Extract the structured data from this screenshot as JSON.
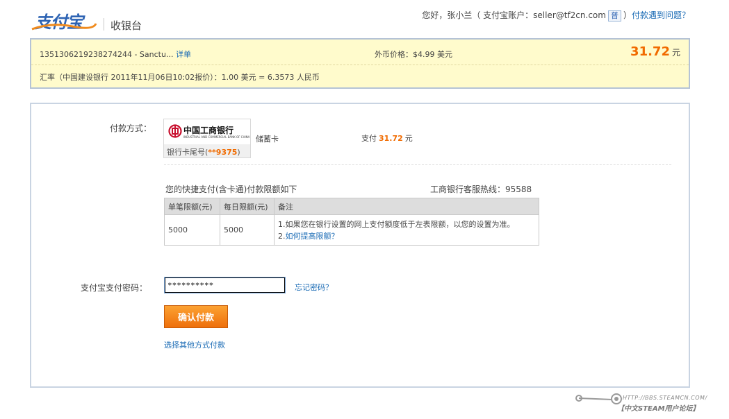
{
  "header": {
    "logo_text": "支付宝",
    "cashier_label": "收银台",
    "greeting": "您好，张小兰（ 支付宝账户：seller@tf2cn.com",
    "account_type_badge": "普",
    "greeting_close": "）",
    "help_link": "付款遇到问题？"
  },
  "order": {
    "id_text": "1351306219238274244 - Sanctu...",
    "detail_link": "详单",
    "foreign_price": "外币价格：$4.99 美元",
    "amount": "31.72",
    "amount_unit": "元",
    "exchange_rate": "汇率（中国建设银行 2011年11月06日10:02报价）：1.00 美元 = 6.3573 人民币"
  },
  "payment": {
    "method_label": "付款方式：",
    "bank": {
      "name": "中国工商银行",
      "english_name": "INDUSTRIAL AND COMMERCIAL BANK OF CHINA",
      "tail_prefix": "银行卡尾号(",
      "tail_digits": "**9375",
      "tail_suffix": ")"
    },
    "card_type": "储蓄卡",
    "pay_prefix": "支付",
    "pay_amount": "31.72",
    "pay_unit": "元"
  },
  "limits": {
    "title": "您的快捷支付(含卡通)付款限额如下",
    "hotline": "工商银行客服热线：95588",
    "headers": [
      "单笔限额(元)",
      "每日限额(元)",
      "备注"
    ],
    "row": {
      "single": "5000",
      "daily": "5000",
      "note_line1": "1.如果您在银行设置的网上支付额度低于左表限额，以您的设置为准。",
      "note_line2_prefix": "2.",
      "note_line2_link": "如何提高限额？"
    }
  },
  "password": {
    "label": "支付宝支付密码：",
    "value": "**********",
    "forgot_link": "忘记密码？"
  },
  "confirm_button": "确认付款",
  "other_method_link": "选择其他方式付款",
  "watermark": {
    "line1": "HTTP://BBS.STEAMCN.COM/",
    "line2": "【中文STEAM用户论坛】"
  },
  "colors": {
    "accent_orange": "#f16b00",
    "link_blue": "#1a6bb5",
    "order_bg": "#fffbcc",
    "brand_blue": "#2d63b3"
  }
}
